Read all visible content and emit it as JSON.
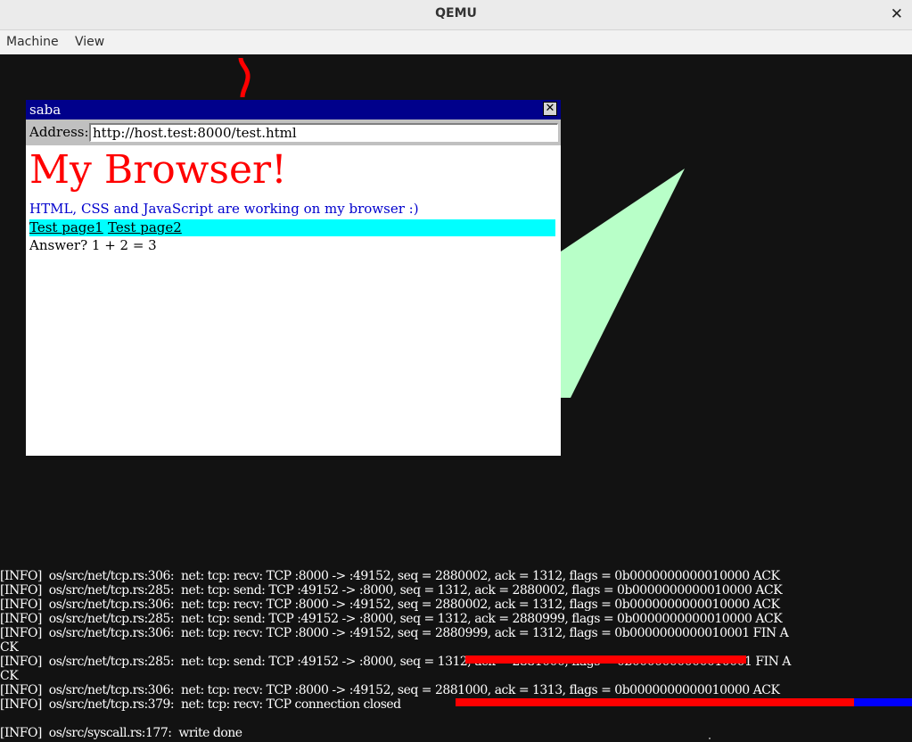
{
  "window": {
    "title": "QEMU",
    "close_symbol": "✕"
  },
  "menu": {
    "items": [
      "Machine",
      "View"
    ]
  },
  "browser": {
    "title": "saba",
    "close_symbol": "✕",
    "address_label": "Address:",
    "address_value": "http://host.test:8000/test.html",
    "heading": "My Browser!",
    "paragraph": "HTML, CSS and JavaScript are working on my browser :)",
    "links": [
      "Test page1",
      "Test page2"
    ],
    "answer": "Answer? 1 + 2 = 3"
  },
  "colors": {
    "heading": "#ff0000",
    "paragraph": "#0000cd",
    "links_bg": "#00ffff",
    "titlebar": "#00008b",
    "shape_green": "#b8ffc8",
    "bar_red": "#ff0000",
    "bar_blue": "#0000ff"
  },
  "console": {
    "lines": [
      "[INFO]  os/src/net/tcp.rs:306:  net: tcp: recv: TCP :8000 -> :49152, seq = 2880002, ack = 1312, flags = 0b0000000000010000 ACK",
      "[INFO]  os/src/net/tcp.rs:285:  net: tcp: send: TCP :49152 -> :8000, seq = 1312, ack = 2880002, flags = 0b0000000000010000 ACK",
      "[INFO]  os/src/net/tcp.rs:306:  net: tcp: recv: TCP :8000 -> :49152, seq = 2880002, ack = 1312, flags = 0b0000000000010000 ACK",
      "[INFO]  os/src/net/tcp.rs:285:  net: tcp: send: TCP :49152 -> :8000, seq = 1312, ack = 2880999, flags = 0b0000000000010000 ACK",
      "[INFO]  os/src/net/tcp.rs:306:  net: tcp: recv: TCP :8000 -> :49152, seq = 2880999, ack = 1312, flags = 0b0000000000010001 FIN A",
      "CK",
      "[INFO]  os/src/net/tcp.rs:285:  net: tcp: send: TCP :49152 -> :8000, seq = 1312, ack = 2881000, flags = 0b0000000000010001 FIN A",
      "CK",
      "[INFO]  os/src/net/tcp.rs:306:  net: tcp: recv: TCP :8000 -> :49152, seq = 2881000, ack = 1313, flags = 0b0000000000010000 ACK",
      "[INFO]  os/src/net/tcp.rs:379:  net: tcp: recv: TCP connection closed",
      "",
      "[INFO]  os/src/syscall.rs:177:  write done"
    ]
  }
}
